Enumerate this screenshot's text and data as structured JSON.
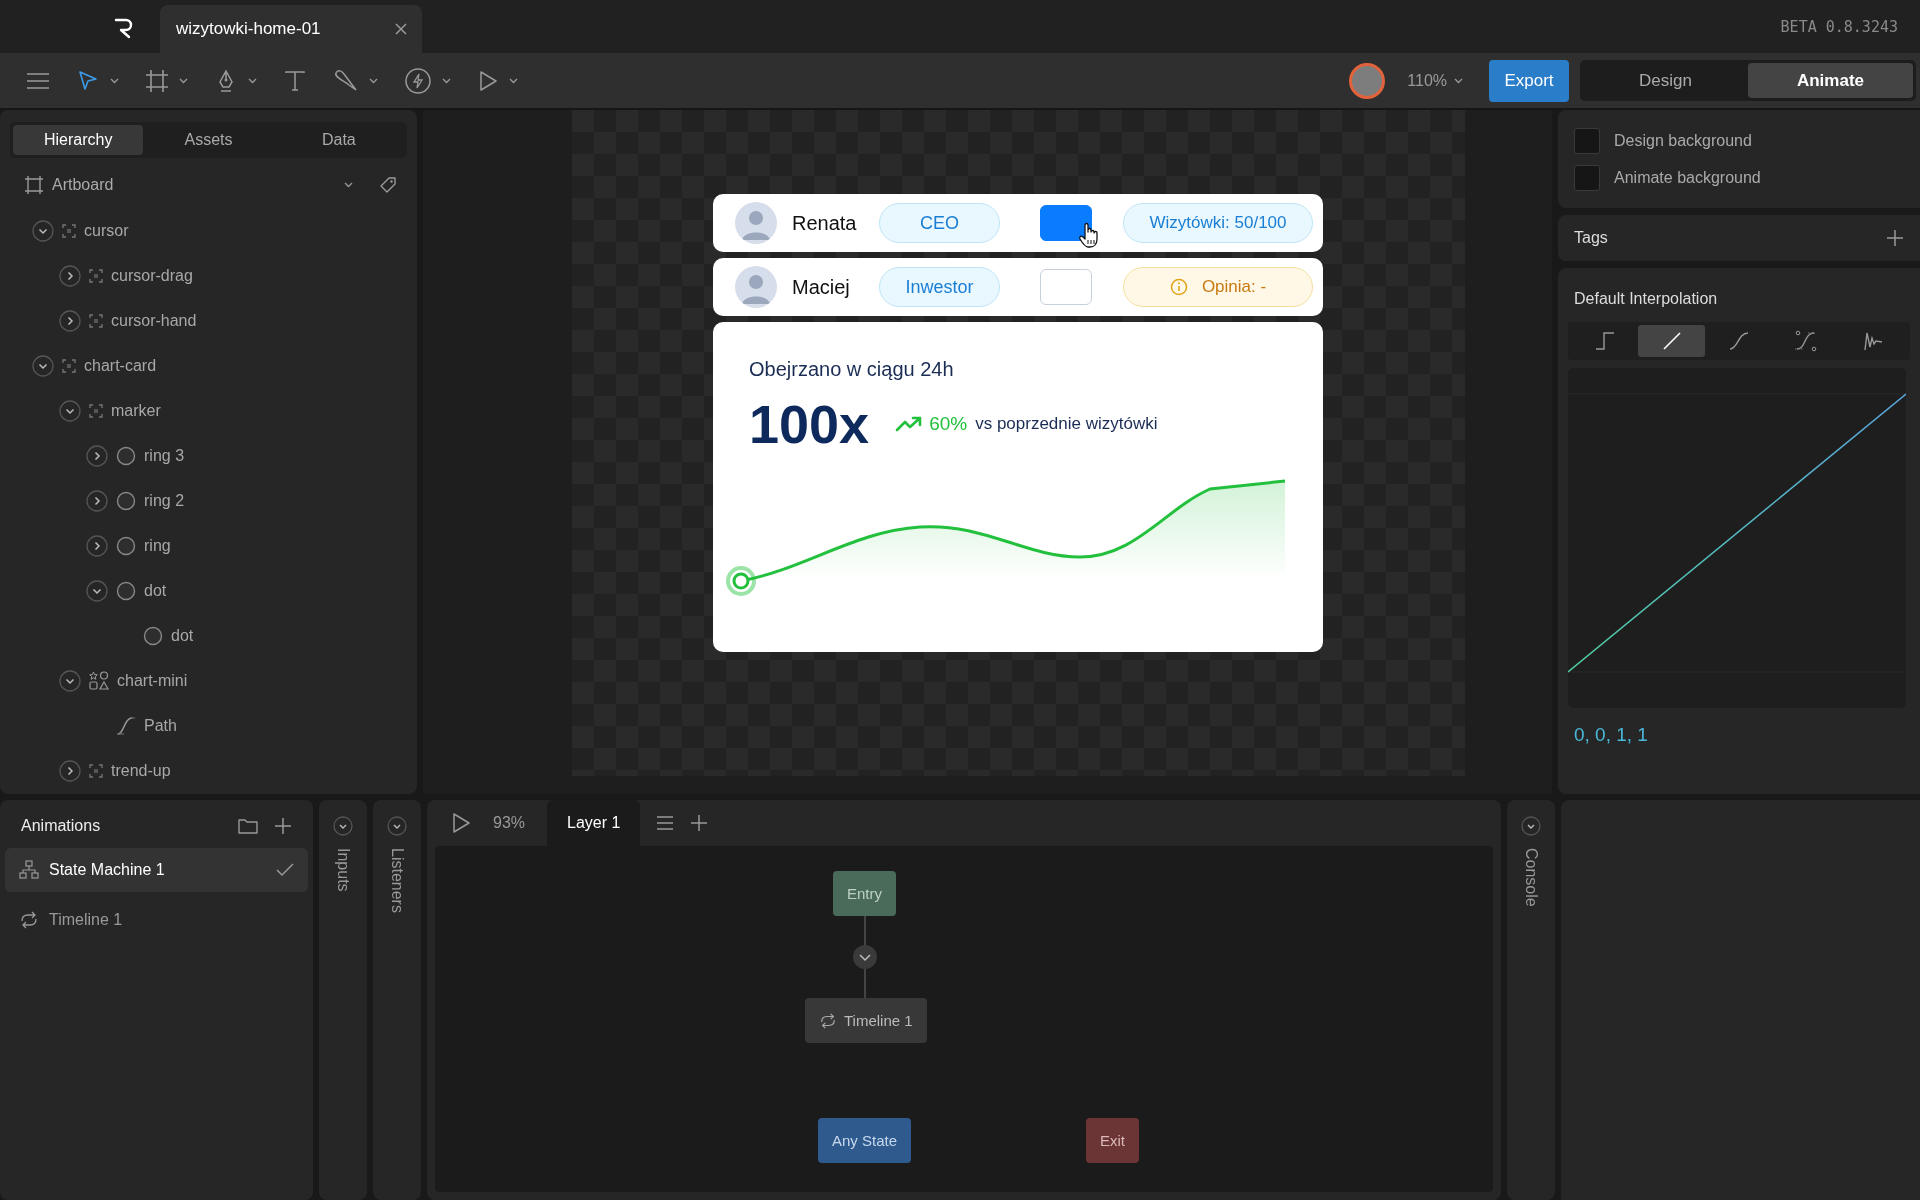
{
  "titlebar": {
    "file_tab": {
      "title": "wizytowki-home-01"
    },
    "version": "BETA 0.8.3243"
  },
  "toolbar": {
    "tools": [
      {
        "kind": "select",
        "selected": true,
        "has_menu": true
      },
      {
        "kind": "frame",
        "selected": false,
        "has_menu": true
      },
      {
        "kind": "pen",
        "selected": false,
        "has_menu": true
      },
      {
        "kind": "text",
        "selected": false,
        "has_menu": false
      },
      {
        "kind": "brush",
        "selected": false,
        "has_menu": true
      },
      {
        "kind": "bolt",
        "selected": false,
        "has_menu": true
      },
      {
        "kind": "play",
        "selected": false,
        "has_menu": true
      }
    ],
    "zoom": "110%",
    "export_label": "Export",
    "modes": [
      {
        "label": "Design",
        "selected": false
      },
      {
        "label": "Animate",
        "selected": true
      }
    ]
  },
  "hierarchy": {
    "tabs": [
      {
        "label": "Hierarchy",
        "selected": true
      },
      {
        "label": "Assets",
        "selected": false
      },
      {
        "label": "Data",
        "selected": false
      }
    ],
    "artboard": "Artboard",
    "items": [
      {
        "name": "cursor",
        "kind": "group",
        "expanded": true,
        "children": [
          {
            "name": "cursor-drag",
            "kind": "group",
            "expanded": false
          },
          {
            "name": "cursor-hand",
            "kind": "group",
            "expanded": false
          }
        ]
      },
      {
        "name": "chart-card",
        "kind": "group",
        "expanded": true,
        "children": [
          {
            "name": "marker",
            "kind": "group",
            "expanded": true,
            "children": [
              {
                "name": "ring 3",
                "kind": "ellipse",
                "expanded": false
              },
              {
                "name": "ring 2",
                "kind": "ellipse",
                "expanded": false
              },
              {
                "name": "ring",
                "kind": "ellipse",
                "expanded": false
              },
              {
                "name": "dot",
                "kind": "ellipse",
                "expanded": true,
                "children": [
                  {
                    "name": "dot",
                    "kind": "ellipse"
                  }
                ]
              }
            ]
          },
          {
            "name": "chart-mini",
            "kind": "shapes",
            "expanded": true,
            "children": [
              {
                "name": "Path",
                "kind": "path"
              }
            ]
          },
          {
            "name": "trend-up",
            "kind": "group",
            "expanded": false
          }
        ]
      }
    ]
  },
  "artboard": {
    "contacts": [
      {
        "name": "Renata",
        "role": "CEO",
        "on": true,
        "badge": {
          "kind": "count",
          "text": "Wizytówki: 50/100"
        }
      },
      {
        "name": "Maciej",
        "role": "Inwestor",
        "on": false,
        "badge": {
          "kind": "warning",
          "text": "Opinia: -"
        }
      }
    ],
    "chart_card": {
      "title": "Obejrzano w ciągu 24h",
      "value": "100x",
      "change": "60%",
      "change_note": "vs poprzednie wizytówki"
    }
  },
  "inspector": {
    "backgrounds": [
      {
        "label": "Design background"
      },
      {
        "label": "Animate background"
      }
    ],
    "tags_title": "Tags",
    "interpolation": {
      "title": "Default Interpolation",
      "options": [
        {
          "kind": "hold",
          "selected": false
        },
        {
          "kind": "linear",
          "selected": true
        },
        {
          "kind": "cubic",
          "selected": false
        },
        {
          "kind": "custom",
          "selected": false
        },
        {
          "kind": "elastic",
          "selected": false
        }
      ],
      "values": "0, 0, 1, 1"
    }
  },
  "animations": {
    "title": "Animations",
    "items": [
      {
        "label": "State Machine 1",
        "kind": "state-machine",
        "selected": true,
        "active": true
      },
      {
        "label": "Timeline 1",
        "kind": "timeline",
        "selected": false,
        "active": false
      }
    ]
  },
  "side_tabs": [
    {
      "label": "Inputs"
    },
    {
      "label": "Listeners"
    }
  ],
  "state_machine": {
    "zoom": "93%",
    "layers": [
      {
        "label": "Layer 1",
        "selected": true
      }
    ],
    "nodes": [
      {
        "label": "Entry",
        "kind": "entry"
      },
      {
        "label": "Timeline 1",
        "kind": "timeline"
      },
      {
        "label": "Any State",
        "kind": "any"
      },
      {
        "label": "Exit",
        "kind": "exit"
      }
    ]
  },
  "console": {
    "label": "Console"
  }
}
